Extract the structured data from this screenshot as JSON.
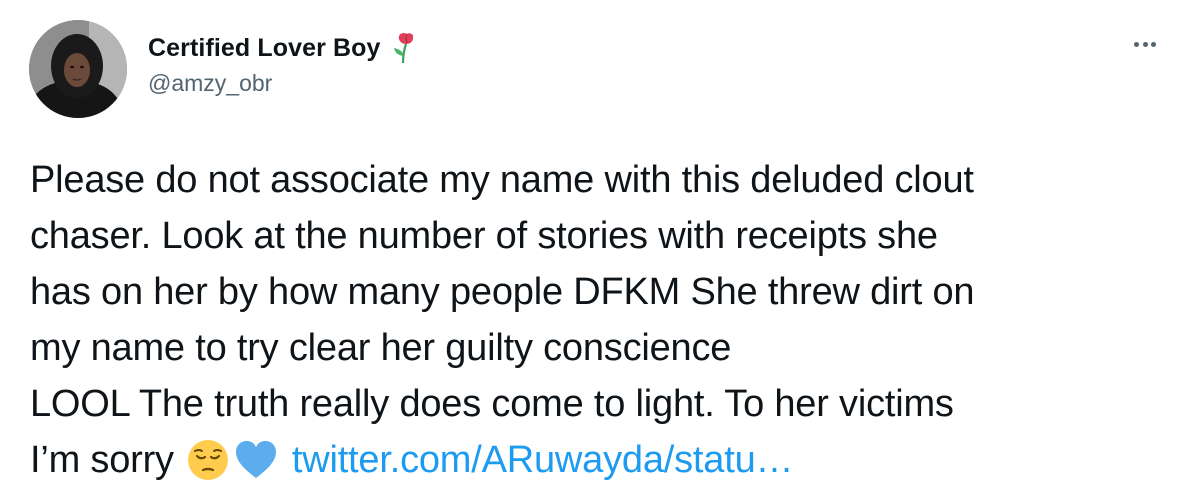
{
  "tweet": {
    "display_name": "Certified Lover Boy",
    "name_emoji_icon": "wilted-rose-icon",
    "handle": "@amzy_obr",
    "more_icon": "more-horizontal-icon",
    "text_lines": "Please do not associate my name with this deluded clout\nchaser. Look at the number of stories with receipts she\nhas on her by how many people DFKM She threw dirt on\nmy name to try clear her guilty conscience\nLOOL The truth really does come to light. To her victims",
    "last_line_text": "I’m sorry",
    "emojis": [
      "pensive-face-icon",
      "blue-heart-icon"
    ],
    "link_text": "twitter.com/ARuwayda/statu…",
    "colors": {
      "text": "#0f1419",
      "secondary": "#536471",
      "link": "#1d9bf0"
    }
  }
}
